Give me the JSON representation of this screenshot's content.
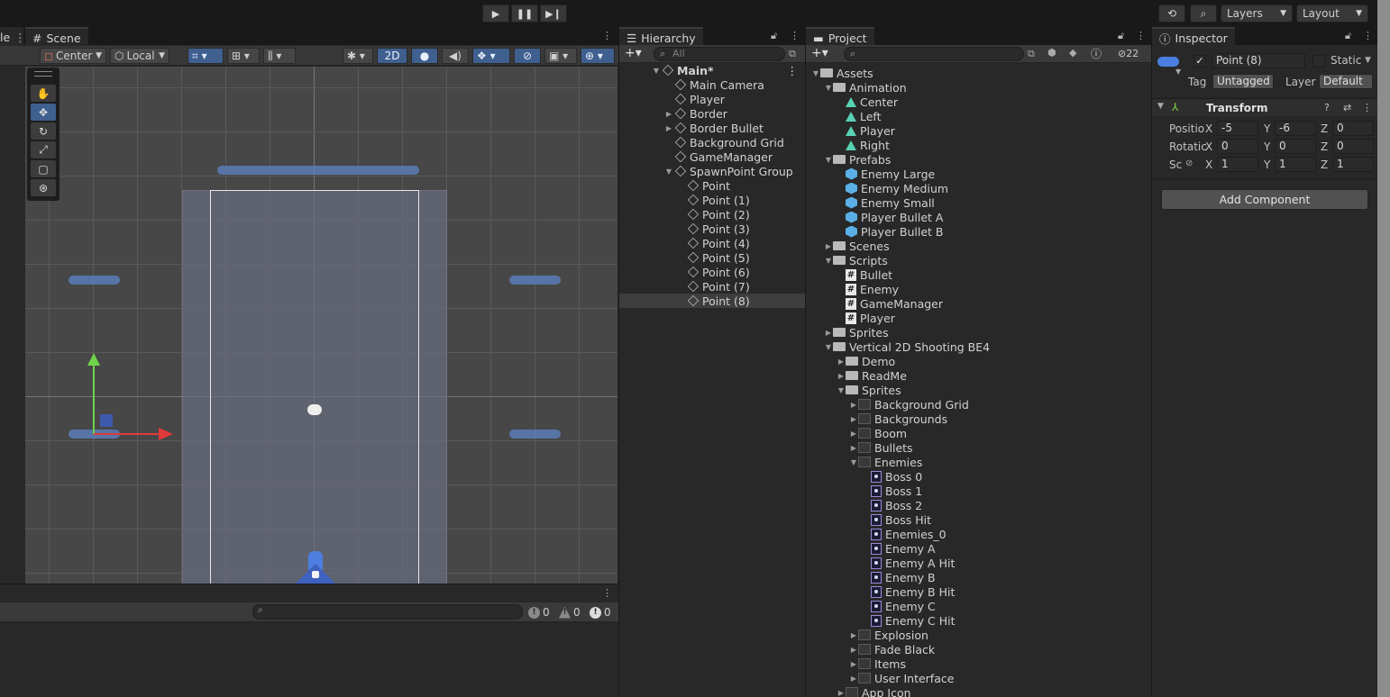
{
  "toolbar": {
    "play": "▶",
    "pause": "❚❚",
    "step": "▶❙",
    "layers_label": "Layers",
    "layout_label": "Layout"
  },
  "scene": {
    "tab_label": "Scene",
    "pivot_label": "Center",
    "space_label": "Local",
    "mode_2d_label": "2D",
    "cut_label": "le"
  },
  "console": {
    "error_count": "0",
    "warning_count": "0",
    "info_count": "0"
  },
  "hierarchy": {
    "tab_label": "Hierarchy",
    "search_placeholder": "All",
    "items": [
      {
        "label": "Main*",
        "depth": 0,
        "arrow": "▼",
        "scene": true
      },
      {
        "label": "Main Camera",
        "depth": 1,
        "arrow": ""
      },
      {
        "label": "Player",
        "depth": 1,
        "arrow": ""
      },
      {
        "label": "Border",
        "depth": 1,
        "arrow": "▶"
      },
      {
        "label": "Border Bullet",
        "depth": 1,
        "arrow": "▶"
      },
      {
        "label": "Background Grid",
        "depth": 1,
        "arrow": ""
      },
      {
        "label": "GameManager",
        "depth": 1,
        "arrow": ""
      },
      {
        "label": "SpawnPoint Group",
        "depth": 1,
        "arrow": "▼"
      },
      {
        "label": "Point",
        "depth": 2,
        "arrow": ""
      },
      {
        "label": "Point (1)",
        "depth": 2,
        "arrow": ""
      },
      {
        "label": "Point (2)",
        "depth": 2,
        "arrow": ""
      },
      {
        "label": "Point (3)",
        "depth": 2,
        "arrow": ""
      },
      {
        "label": "Point (4)",
        "depth": 2,
        "arrow": ""
      },
      {
        "label": "Point (5)",
        "depth": 2,
        "arrow": ""
      },
      {
        "label": "Point (6)",
        "depth": 2,
        "arrow": ""
      },
      {
        "label": "Point (7)",
        "depth": 2,
        "arrow": ""
      },
      {
        "label": "Point (8)",
        "depth": 2,
        "arrow": "",
        "selected": true
      }
    ]
  },
  "project": {
    "tab_label": "Project",
    "hidden_count": "22",
    "items": [
      {
        "label": "Assets",
        "depth": 0,
        "arrow": "▼",
        "icon": "folder"
      },
      {
        "label": "Animation",
        "depth": 1,
        "arrow": "▼",
        "icon": "folder"
      },
      {
        "label": "Center",
        "depth": 2,
        "arrow": "",
        "icon": "anim"
      },
      {
        "label": "Left",
        "depth": 2,
        "arrow": "",
        "icon": "anim"
      },
      {
        "label": "Player",
        "depth": 2,
        "arrow": "",
        "icon": "animator"
      },
      {
        "label": "Right",
        "depth": 2,
        "arrow": "",
        "icon": "anim"
      },
      {
        "label": "Prefabs",
        "depth": 1,
        "arrow": "▼",
        "icon": "folder"
      },
      {
        "label": "Enemy Large",
        "depth": 2,
        "arrow": "",
        "icon": "prefab"
      },
      {
        "label": "Enemy Medium",
        "depth": 2,
        "arrow": "",
        "icon": "prefab"
      },
      {
        "label": "Enemy Small",
        "depth": 2,
        "arrow": "",
        "icon": "prefab"
      },
      {
        "label": "Player Bullet A",
        "depth": 2,
        "arrow": "",
        "icon": "prefab"
      },
      {
        "label": "Player Bullet B",
        "depth": 2,
        "arrow": "",
        "icon": "prefab"
      },
      {
        "label": "Scenes",
        "depth": 1,
        "arrow": "▶",
        "icon": "folder"
      },
      {
        "label": "Scripts",
        "depth": 1,
        "arrow": "▼",
        "icon": "folder"
      },
      {
        "label": "Bullet",
        "depth": 2,
        "arrow": "",
        "icon": "script"
      },
      {
        "label": "Enemy",
        "depth": 2,
        "arrow": "",
        "icon": "script"
      },
      {
        "label": "GameManager",
        "depth": 2,
        "arrow": "",
        "icon": "script"
      },
      {
        "label": "Player",
        "depth": 2,
        "arrow": "",
        "icon": "script"
      },
      {
        "label": "Sprites",
        "depth": 1,
        "arrow": "▶",
        "icon": "folder"
      },
      {
        "label": "Vertical 2D Shooting BE4",
        "depth": 1,
        "arrow": "▼",
        "icon": "folder"
      },
      {
        "label": "Demo",
        "depth": 2,
        "arrow": "▶",
        "icon": "folder"
      },
      {
        "label": "ReadMe",
        "depth": 2,
        "arrow": "▶",
        "icon": "folder"
      },
      {
        "label": "Sprites",
        "depth": 2,
        "arrow": "▼",
        "icon": "folder"
      },
      {
        "label": "Background Grid",
        "depth": 3,
        "arrow": "▶",
        "icon": "sheet"
      },
      {
        "label": "Backgrounds",
        "depth": 3,
        "arrow": "▶",
        "icon": "sheet"
      },
      {
        "label": "Boom",
        "depth": 3,
        "arrow": "▶",
        "icon": "sheet"
      },
      {
        "label": "Bullets",
        "depth": 3,
        "arrow": "▶",
        "icon": "sheet"
      },
      {
        "label": "Enemies",
        "depth": 3,
        "arrow": "▼",
        "icon": "sheet"
      },
      {
        "label": "Boss 0",
        "depth": 4,
        "arrow": "",
        "icon": "sprite"
      },
      {
        "label": "Boss 1",
        "depth": 4,
        "arrow": "",
        "icon": "sprite"
      },
      {
        "label": "Boss 2",
        "depth": 4,
        "arrow": "",
        "icon": "sprite"
      },
      {
        "label": "Boss Hit",
        "depth": 4,
        "arrow": "",
        "icon": "sprite"
      },
      {
        "label": "Enemies_0",
        "depth": 4,
        "arrow": "",
        "icon": "sprite"
      },
      {
        "label": "Enemy A",
        "depth": 4,
        "arrow": "",
        "icon": "sprite"
      },
      {
        "label": "Enemy A Hit",
        "depth": 4,
        "arrow": "",
        "icon": "sprite"
      },
      {
        "label": "Enemy B",
        "depth": 4,
        "arrow": "",
        "icon": "sprite"
      },
      {
        "label": "Enemy B Hit",
        "depth": 4,
        "arrow": "",
        "icon": "sprite"
      },
      {
        "label": "Enemy C",
        "depth": 4,
        "arrow": "",
        "icon": "sprite"
      },
      {
        "label": "Enemy C Hit",
        "depth": 4,
        "arrow": "",
        "icon": "sprite"
      },
      {
        "label": "Explosion",
        "depth": 3,
        "arrow": "▶",
        "icon": "sheet"
      },
      {
        "label": "Fade Black",
        "depth": 3,
        "arrow": "▶",
        "icon": "sheet"
      },
      {
        "label": "Items",
        "depth": 3,
        "arrow": "▶",
        "icon": "sheet"
      },
      {
        "label": "User Interface",
        "depth": 3,
        "arrow": "▶",
        "icon": "sheet"
      },
      {
        "label": "App Icon",
        "depth": 2,
        "arrow": "▶",
        "icon": "sheet"
      }
    ]
  },
  "inspector": {
    "tab_label": "Inspector",
    "object_name": "Point (8)",
    "static_label": "Static",
    "tag_label": "Tag",
    "tag_value": "Untagged",
    "layer_label": "Layer",
    "layer_value": "Default",
    "component_title": "Transform",
    "position_label": "Positio",
    "rotation_label": "Rotatic",
    "scale_label": "Sc",
    "position": {
      "x": "-5",
      "y": "-6",
      "z": "0"
    },
    "rotation": {
      "x": "0",
      "y": "0",
      "z": "0"
    },
    "scale": {
      "x": "1",
      "y": "1",
      "z": "1"
    },
    "add_component_label": "Add Component"
  },
  "colors": {
    "selection": "#3e5f96",
    "accent": "#3f5f8f",
    "panel": "#282828",
    "background": "#191919"
  }
}
